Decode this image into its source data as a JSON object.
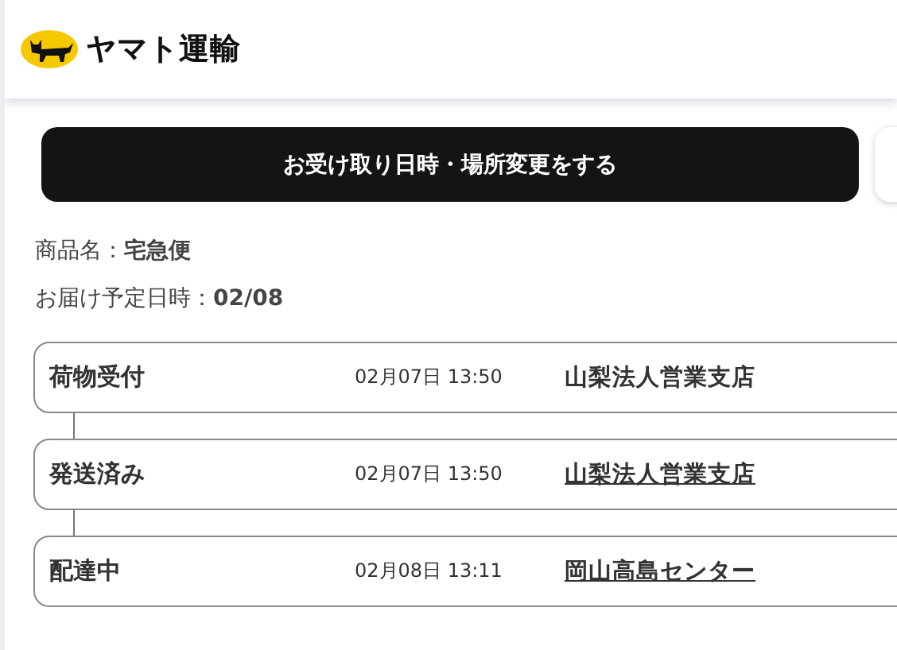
{
  "header": {
    "logo_text": "ヤマト運輸"
  },
  "action_button": {
    "label": "お受け取り日時・場所変更をする"
  },
  "info": [
    {
      "label": "商品名：",
      "value": "宅急便"
    },
    {
      "label": "お届け予定日時：",
      "value": "02/08"
    }
  ],
  "events": [
    {
      "status": "荷物受付",
      "time": "02月07日 13:50",
      "place": "山梨法人営業支店",
      "link": false
    },
    {
      "status": "発送済み",
      "time": "02月07日 13:50",
      "place": "山梨法人営業支店",
      "link": true
    },
    {
      "status": "配達中",
      "time": "02月08日 13:11",
      "place": "岡山高島センター",
      "link": true
    }
  ]
}
